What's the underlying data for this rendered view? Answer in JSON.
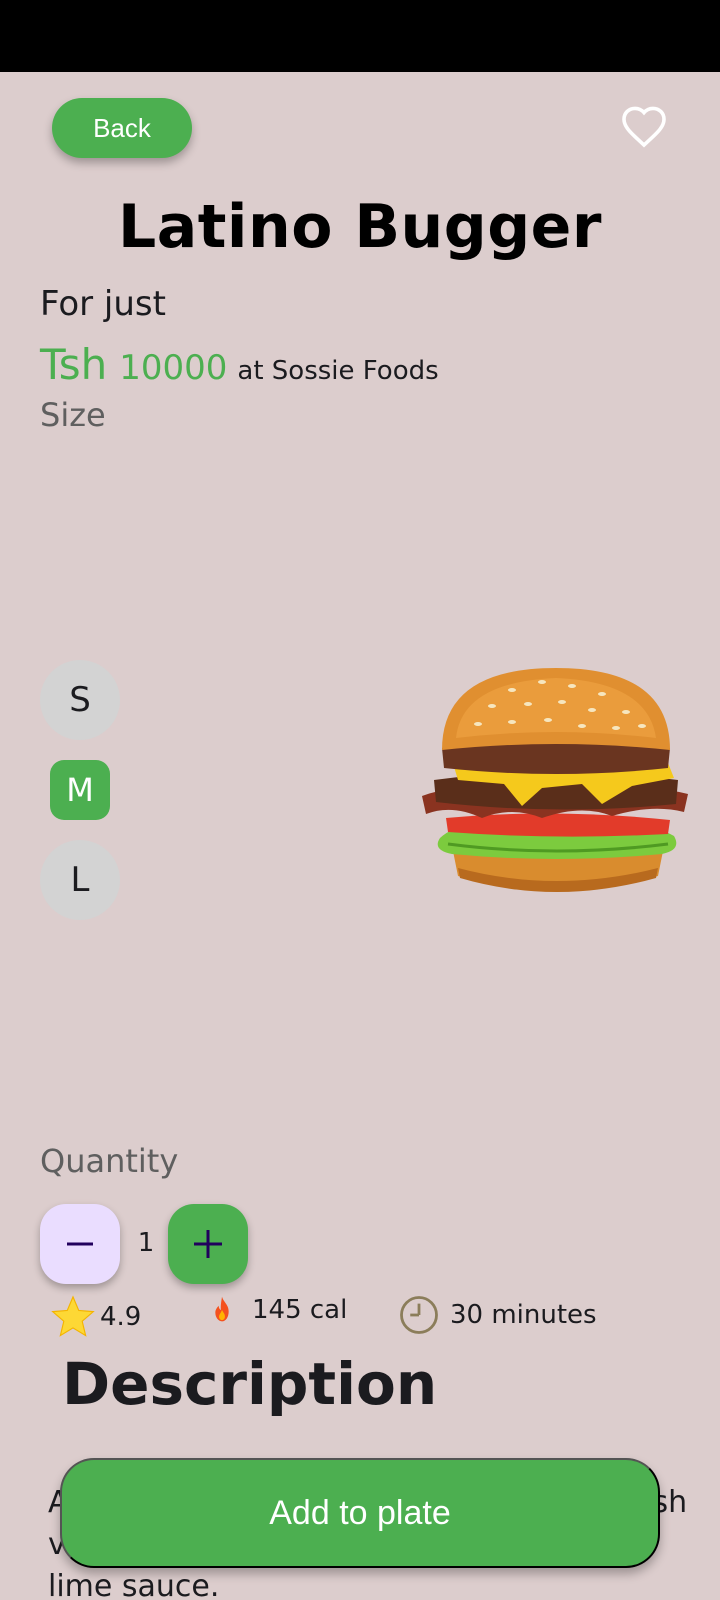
{
  "header": {
    "back_label": "Back",
    "favorite_icon": "heart-outline-icon"
  },
  "product": {
    "name": "Latino Bugger",
    "for_just": "For just",
    "currency": "Tsh",
    "price": "10000",
    "vendor_text": "at Sossie Foods",
    "image_icon": "burger-image"
  },
  "size": {
    "label": "Size",
    "options": [
      "S",
      "M",
      "L"
    ],
    "selected": "M"
  },
  "quantity": {
    "label": "Quantity",
    "value": "1",
    "minus_icon": "minus-icon",
    "plus_icon": "plus-icon"
  },
  "stats": {
    "rating": "4.9",
    "calories": "145 cal",
    "time": "30 minutes"
  },
  "description": {
    "title": "Description",
    "text": "A cheesy burger stacked with bacon, fresh veggies, pickles, jalapenos, and cilantro lime sauce."
  },
  "cta": {
    "add_label": "Add to plate"
  },
  "colors": {
    "accent": "#4caf50",
    "background": "#dccdcd",
    "minus_bg": "#eaddff"
  }
}
